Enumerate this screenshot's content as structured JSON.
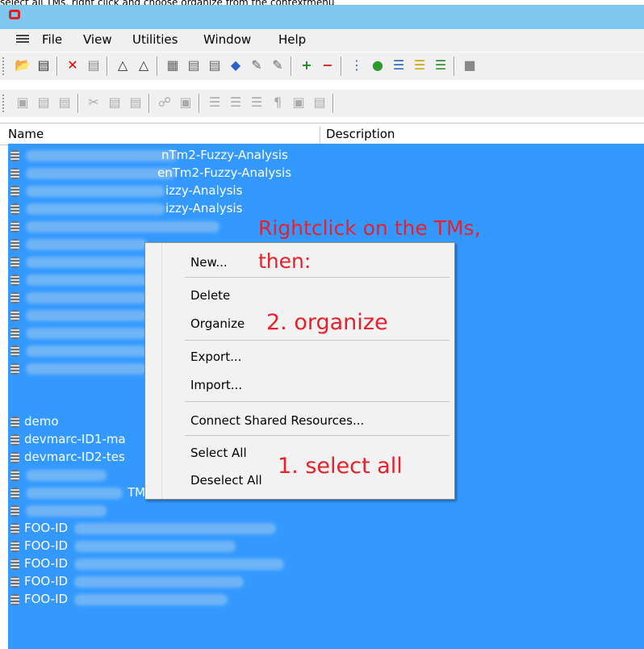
{
  "caption": "select all TMs, right click and choose organize from the contextmenu",
  "menubar": {
    "items": [
      "File",
      "View",
      "Utilities",
      "Window",
      "Help"
    ]
  },
  "toolbar1": {
    "icons": [
      "open-folder-icon",
      "print-icon",
      "delete-x-icon",
      "copy-doc-icon",
      "move-up-doc-icon",
      "move-down-doc-icon",
      "grid-icon",
      "tree-icon",
      "export-icon",
      "tag-icon",
      "edit-a-icon",
      "edit-b-icon",
      "add-item-icon",
      "remove-item-icon",
      "list-icon",
      "globe-icon",
      "bullets-icon",
      "bullets-yellow-icon",
      "checklist-icon",
      "more-icon"
    ]
  },
  "toolbar2": {
    "icons": [
      "disk-icon",
      "save-icon",
      "print2-icon",
      "cut-icon",
      "copy-icon",
      "paste-icon",
      "link-icon",
      "archive-icon",
      "align-left-icon",
      "align-center-icon",
      "align-right-icon",
      "pilcrow-icon",
      "monitor-icon",
      "page-icon"
    ]
  },
  "columns": {
    "name": "Name",
    "description": "Description"
  },
  "rows": [
    {
      "text": "nTm2-Fuzzy-Analysis"
    },
    {
      "text": "enTm2-Fuzzy-Analysis"
    },
    {
      "text": "izzy-Analysis"
    },
    {
      "text": "izzy-Analysis"
    },
    {
      "text": ""
    },
    {
      "text": ""
    },
    {
      "text": ""
    },
    {
      "text": ""
    },
    {
      "text": ""
    },
    {
      "text": ""
    },
    {
      "text": ""
    },
    {
      "text": ""
    },
    {
      "text": ""
    },
    {
      "text": "demo"
    },
    {
      "text": "devmarc-ID1-ma"
    },
    {
      "text": "devmarc-ID2-tes"
    },
    {
      "text": ""
    },
    {
      "text": "TM"
    },
    {
      "text": ""
    },
    {
      "text": "FOO-ID"
    },
    {
      "text": "FOO-ID"
    },
    {
      "text": "FOO-ID"
    },
    {
      "text": "FOO-ID"
    },
    {
      "text": "FOO-ID"
    }
  ],
  "context_menu": {
    "new": "New...",
    "delete": "Delete",
    "organize": "Organize",
    "export": "Export...",
    "import": "Import...",
    "connect": "Connect Shared Resources...",
    "select_all": "Select All",
    "deselect_all": "Deselect All"
  },
  "annotations": {
    "rightclick": "Rightclick on the TMs,",
    "then": "then:",
    "organize": "2. organize",
    "select_all": "1. select all"
  },
  "colors": {
    "selection": "#3399ff",
    "annotation": "#e8202a",
    "titlebar": "#7ec8f0"
  }
}
